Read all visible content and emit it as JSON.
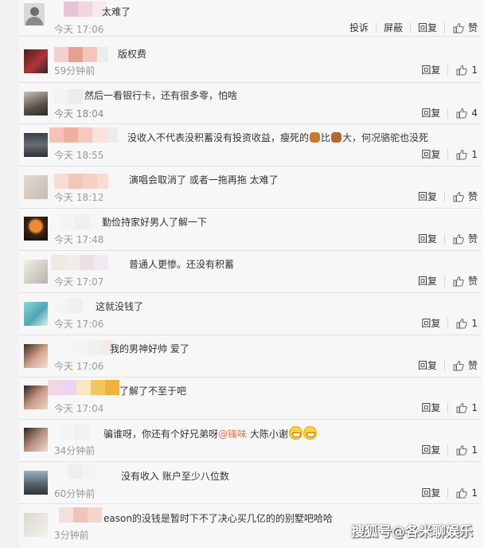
{
  "comments": [
    {
      "text": "太难了",
      "time": "今天 17:06",
      "actions": [
        "投诉",
        "屏蔽",
        "回复"
      ],
      "likes": "赞"
    },
    {
      "text": "版权费",
      "time": "59分钟前",
      "actions": [
        "回复"
      ],
      "likes": "1"
    },
    {
      "text": "然后一看银行卡，还有很多零，怕啥",
      "time": "今天 18:04",
      "actions": [
        "回复"
      ],
      "likes": "4"
    },
    {
      "text_a": "没收入不代表没积蓄没有投资收益，瘦死的",
      "text_b": "比",
      "text_c": "大，何况骆驼也没死",
      "time": "今天 18:55",
      "actions": [
        "回复"
      ],
      "likes": "1"
    },
    {
      "text": "演唱会取消了 或者一拖再拖 太难了",
      "time": "今天 18:12",
      "actions": [
        "回复"
      ],
      "likes": "赞"
    },
    {
      "text": "勤俭持家好男人了解一下",
      "time": "今天 17:48",
      "actions": [
        "回复"
      ],
      "likes": "赞"
    },
    {
      "text": "普通人更惨。还没有积蓄",
      "time": "今天 17:07",
      "actions": [
        "回复"
      ],
      "likes": "赞"
    },
    {
      "text": "这就没钱了",
      "time": "今天 17:06",
      "actions": [
        "回复"
      ],
      "likes": "1"
    },
    {
      "text": "我的男神好帅  爱了",
      "time": "今天 17:06",
      "actions": [
        "回复"
      ],
      "likes": "赞"
    },
    {
      "text": "了解了不至于吧",
      "time": "今天 17:04",
      "actions": [
        "回复"
      ],
      "likes": "1"
    },
    {
      "text_a": "骗谁呀，你还有个好兄弟呀",
      "mention": "@锋味",
      "text_b": " 大陈小谢",
      "time": "34分钟前",
      "actions": [
        "回复"
      ],
      "likes": "1"
    },
    {
      "text": "没有收入 账户至少八位数",
      "time": "60分钟前",
      "actions": [
        "回复"
      ],
      "likes": "1"
    },
    {
      "text": "eason的没钱是暂时下不了决心买几亿的的别墅吧哈哈",
      "time": "3分钟前",
      "actions": [],
      "likes": ""
    }
  ],
  "watermark": "搜狐号@各米聊娱乐",
  "icons": {
    "like": "thumbs-up-icon",
    "animal": "dog-emoji-icon",
    "grin": "grin-emoji-icon"
  },
  "colors": {
    "mention": "#eb7350",
    "text": "#333333",
    "time": "#999999",
    "divider": "#e1e1e1"
  }
}
